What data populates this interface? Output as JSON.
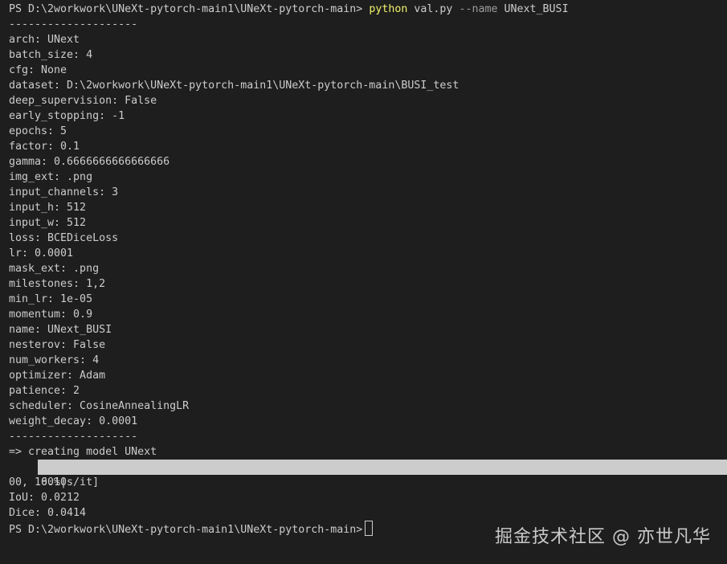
{
  "terminal": {
    "prompt_top": "PS D:\\2workwork\\UNeXt-pytorch-main1\\UNeXt-pytorch-main>",
    "command": "python",
    "command_args_1": "val.py",
    "command_flag": "--name",
    "command_args_2": "UNext_BUSI",
    "separator": "--------------------",
    "config_lines": [
      "arch: UNext",
      "batch_size: 4",
      "cfg: None",
      "dataset: D:\\2workwork\\UNeXt-pytorch-main1\\UNeXt-pytorch-main\\BUSI_test",
      "deep_supervision: False",
      "early_stopping: -1",
      "epochs: 5",
      "factor: 0.1",
      "gamma: 0.6666666666666666",
      "img_ext: .png",
      "input_channels: 3",
      "input_h: 512",
      "input_w: 512",
      "loss: BCEDiceLoss",
      "lr: 0.0001",
      "mask_ext: .png",
      "milestones: 1,2",
      "min_lr: 1e-05",
      "momentum: 0.9",
      "name: UNext_BUSI",
      "nesterov: False",
      "num_workers: 4",
      "optimizer: Adam",
      "patience: 2",
      "scheduler: CosineAnnealingLR",
      "weight_decay: 0.0001"
    ],
    "creating_model": "=> creating model UNext",
    "progress_text": "100%|",
    "progress_percent": 100,
    "progress_tail": "00,  6.10s/it]",
    "iou": "IoU: 0.0212",
    "dice": "Dice: 0.0414",
    "prompt_bottom": "PS D:\\2workwork\\UNeXt-pytorch-main1\\UNeXt-pytorch-main>"
  },
  "watermark": "掘金技术社区 @ 亦世凡华",
  "colors": {
    "background": "#1e1e1e",
    "text": "#cccccc",
    "command": "#f1f16c",
    "flag": "#9d9d9d",
    "progress_fill": "#cccccc"
  }
}
